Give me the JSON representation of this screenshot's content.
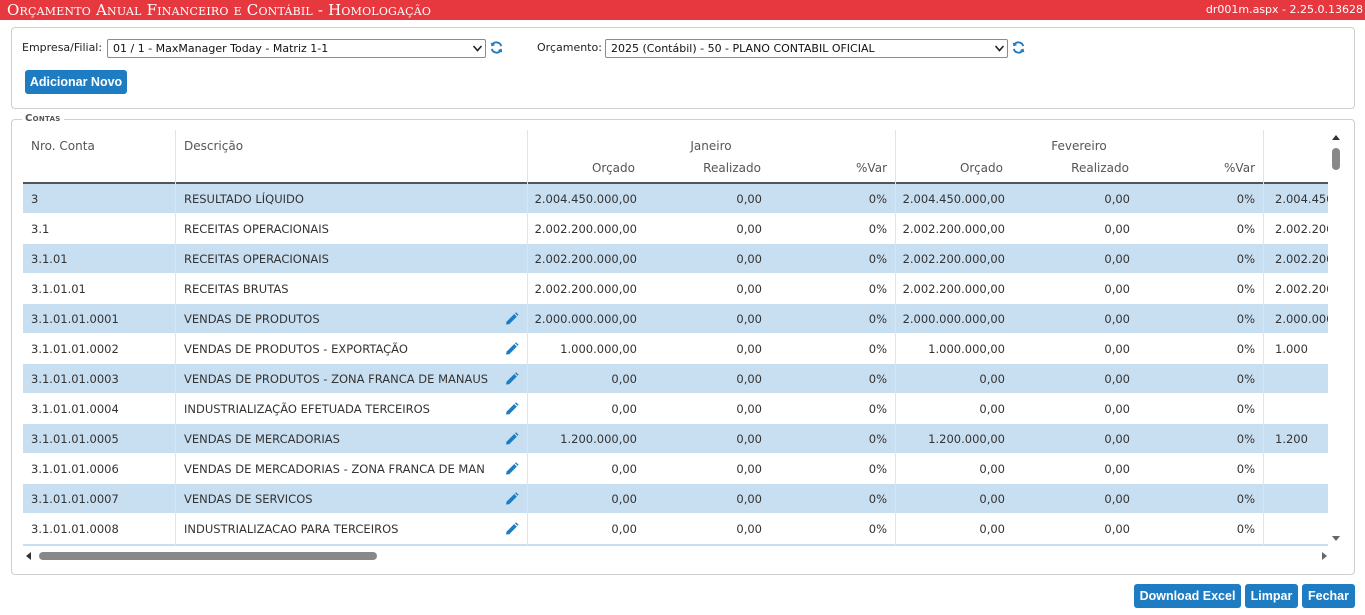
{
  "header": {
    "title": "Orçamento Anual Financeiro e Contábil  - Homologação",
    "version": "dr001m.aspx - 2.25.0.13628"
  },
  "filters": {
    "empresa_label": "Empresa/Filial:",
    "empresa_value": "01 / 1 - MaxManager Today - Matriz 1-1",
    "orcamento_label": "Orçamento:",
    "orcamento_value": "2025 (Contábil) - 50 - PLANO CONTABIL OFICIAL",
    "add_button": "Adicionar Novo"
  },
  "contas": {
    "legend": "Contas",
    "columns": {
      "nro_conta": "Nro. Conta",
      "descricao": "Descrição",
      "months": [
        {
          "name": "Janeiro",
          "orcado": "Orçado",
          "realizado": "Realizado",
          "var": "%Var"
        },
        {
          "name": "Fevereiro",
          "orcado": "Orçado",
          "realizado": "Realizado",
          "var": "%Var"
        }
      ]
    },
    "rows": [
      {
        "conta": "3",
        "descricao": "RESULTADO LÍQUIDO",
        "edit": false,
        "jan_orcado": "2.004.450.000,00",
        "jan_realizado": "0,00",
        "jan_var": "0%",
        "fev_orcado": "2.004.450.000,00",
        "fev_realizado": "0,00",
        "fev_var": "0%",
        "mar_orcado": "2.004.450"
      },
      {
        "conta": "3.1",
        "descricao": "RECEITAS OPERACIONAIS",
        "edit": false,
        "jan_orcado": "2.002.200.000,00",
        "jan_realizado": "0,00",
        "jan_var": "0%",
        "fev_orcado": "2.002.200.000,00",
        "fev_realizado": "0,00",
        "fev_var": "0%",
        "mar_orcado": "2.002.200"
      },
      {
        "conta": "3.1.01",
        "descricao": "RECEITAS OPERACIONAIS",
        "edit": false,
        "jan_orcado": "2.002.200.000,00",
        "jan_realizado": "0,00",
        "jan_var": "0%",
        "fev_orcado": "2.002.200.000,00",
        "fev_realizado": "0,00",
        "fev_var": "0%",
        "mar_orcado": "2.002.200"
      },
      {
        "conta": "3.1.01.01",
        "descricao": "RECEITAS BRUTAS",
        "edit": false,
        "jan_orcado": "2.002.200.000,00",
        "jan_realizado": "0,00",
        "jan_var": "0%",
        "fev_orcado": "2.002.200.000,00",
        "fev_realizado": "0,00",
        "fev_var": "0%",
        "mar_orcado": "2.002.200"
      },
      {
        "conta": "3.1.01.01.0001",
        "descricao": "VENDAS DE PRODUTOS",
        "edit": true,
        "jan_orcado": "2.000.000.000,00",
        "jan_realizado": "0,00",
        "jan_var": "0%",
        "fev_orcado": "2.000.000.000,00",
        "fev_realizado": "0,00",
        "fev_var": "0%",
        "mar_orcado": "2.000.000"
      },
      {
        "conta": "3.1.01.01.0002",
        "descricao": "VENDAS DE PRODUTOS - EXPORTAÇÃO",
        "edit": true,
        "jan_orcado": "1.000.000,00",
        "jan_realizado": "0,00",
        "jan_var": "0%",
        "fev_orcado": "1.000.000,00",
        "fev_realizado": "0,00",
        "fev_var": "0%",
        "mar_orcado": "1.000"
      },
      {
        "conta": "3.1.01.01.0003",
        "descricao": "VENDAS DE PRODUTOS - ZONA FRANCA DE MANAUS",
        "edit": true,
        "jan_orcado": "0,00",
        "jan_realizado": "0,00",
        "jan_var": "0%",
        "fev_orcado": "0,00",
        "fev_realizado": "0,00",
        "fev_var": "0%",
        "mar_orcado": ""
      },
      {
        "conta": "3.1.01.01.0004",
        "descricao": "INDUSTRIALIZAÇÃO EFETUADA TERCEIROS",
        "edit": true,
        "jan_orcado": "0,00",
        "jan_realizado": "0,00",
        "jan_var": "0%",
        "fev_orcado": "0,00",
        "fev_realizado": "0,00",
        "fev_var": "0%",
        "mar_orcado": ""
      },
      {
        "conta": "3.1.01.01.0005",
        "descricao": "VENDAS DE MERCADORIAS",
        "edit": true,
        "jan_orcado": "1.200.000,00",
        "jan_realizado": "0,00",
        "jan_var": "0%",
        "fev_orcado": "1.200.000,00",
        "fev_realizado": "0,00",
        "fev_var": "0%",
        "mar_orcado": "1.200"
      },
      {
        "conta": "3.1.01.01.0006",
        "descricao": "VENDAS DE MERCADORIAS - ZONA FRANCA DE MAN",
        "edit": true,
        "jan_orcado": "0,00",
        "jan_realizado": "0,00",
        "jan_var": "0%",
        "fev_orcado": "0,00",
        "fev_realizado": "0,00",
        "fev_var": "0%",
        "mar_orcado": ""
      },
      {
        "conta": "3.1.01.01.0007",
        "descricao": "VENDAS DE SERVICOS",
        "edit": true,
        "jan_orcado": "0,00",
        "jan_realizado": "0,00",
        "jan_var": "0%",
        "fev_orcado": "0,00",
        "fev_realizado": "0,00",
        "fev_var": "0%",
        "mar_orcado": ""
      },
      {
        "conta": "3.1.01.01.0008",
        "descricao": "INDUSTRIALIZACAO PARA TERCEIROS",
        "edit": true,
        "jan_orcado": "0,00",
        "jan_realizado": "0,00",
        "jan_var": "0%",
        "fev_orcado": "0,00",
        "fev_realizado": "0,00",
        "fev_var": "0%",
        "mar_orcado": ""
      }
    ]
  },
  "footer": {
    "download": "Download Excel",
    "limpar": "Limpar",
    "fechar": "Fechar"
  },
  "icons": {
    "refresh": "refresh-icon",
    "edit": "pencil-icon"
  },
  "colors": {
    "titlebar": "#e8383f",
    "button": "#1e7cc2",
    "row_alt": "#c8dff2",
    "icon": "#1e7cc2"
  }
}
